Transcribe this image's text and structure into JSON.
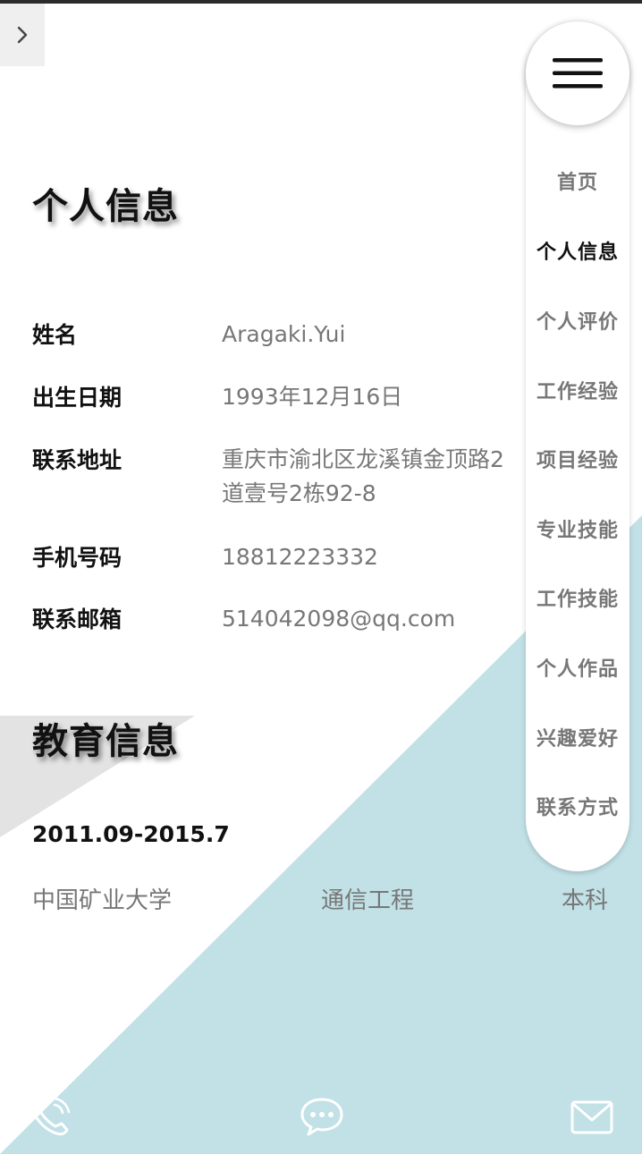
{
  "nav": {
    "items": [
      "首页",
      "个人信息",
      "个人评价",
      "工作经验",
      "项目经验",
      "专业技能",
      "工作技能",
      "个人作品",
      "兴趣爱好",
      "联系方式"
    ],
    "active_item": "个人信息"
  },
  "personal": {
    "title": "个人信息",
    "rows": [
      {
        "label": "姓名",
        "value": "Aragaki.Yui"
      },
      {
        "label": "出生日期",
        "value": "1993年12月16日"
      },
      {
        "label": "联系地址",
        "value_line1": "重庆市渝北区龙溪镇金顶路2",
        "value_line2": "道壹号2栋92-8"
      },
      {
        "label": "手机号码",
        "value": "18812223332"
      },
      {
        "label": "联系邮箱",
        "value": "514042098@qq.com"
      }
    ]
  },
  "education": {
    "title": "教育信息",
    "period": "2011.09-2015.7",
    "school": "中国矿业大学",
    "major": "通信工程",
    "degree": "本科"
  },
  "icons": {
    "expand": "chevron-right-icon",
    "menu": "hamburger-menu-icon",
    "phone": "phone-icon",
    "chat": "chat-bubble-icon",
    "mail": "mail-icon"
  },
  "colors": {
    "accent_bg": "#c1e1e6",
    "triangle_gray": "#e3e3e3",
    "label_text": "#111111",
    "value_text": "#777777"
  }
}
